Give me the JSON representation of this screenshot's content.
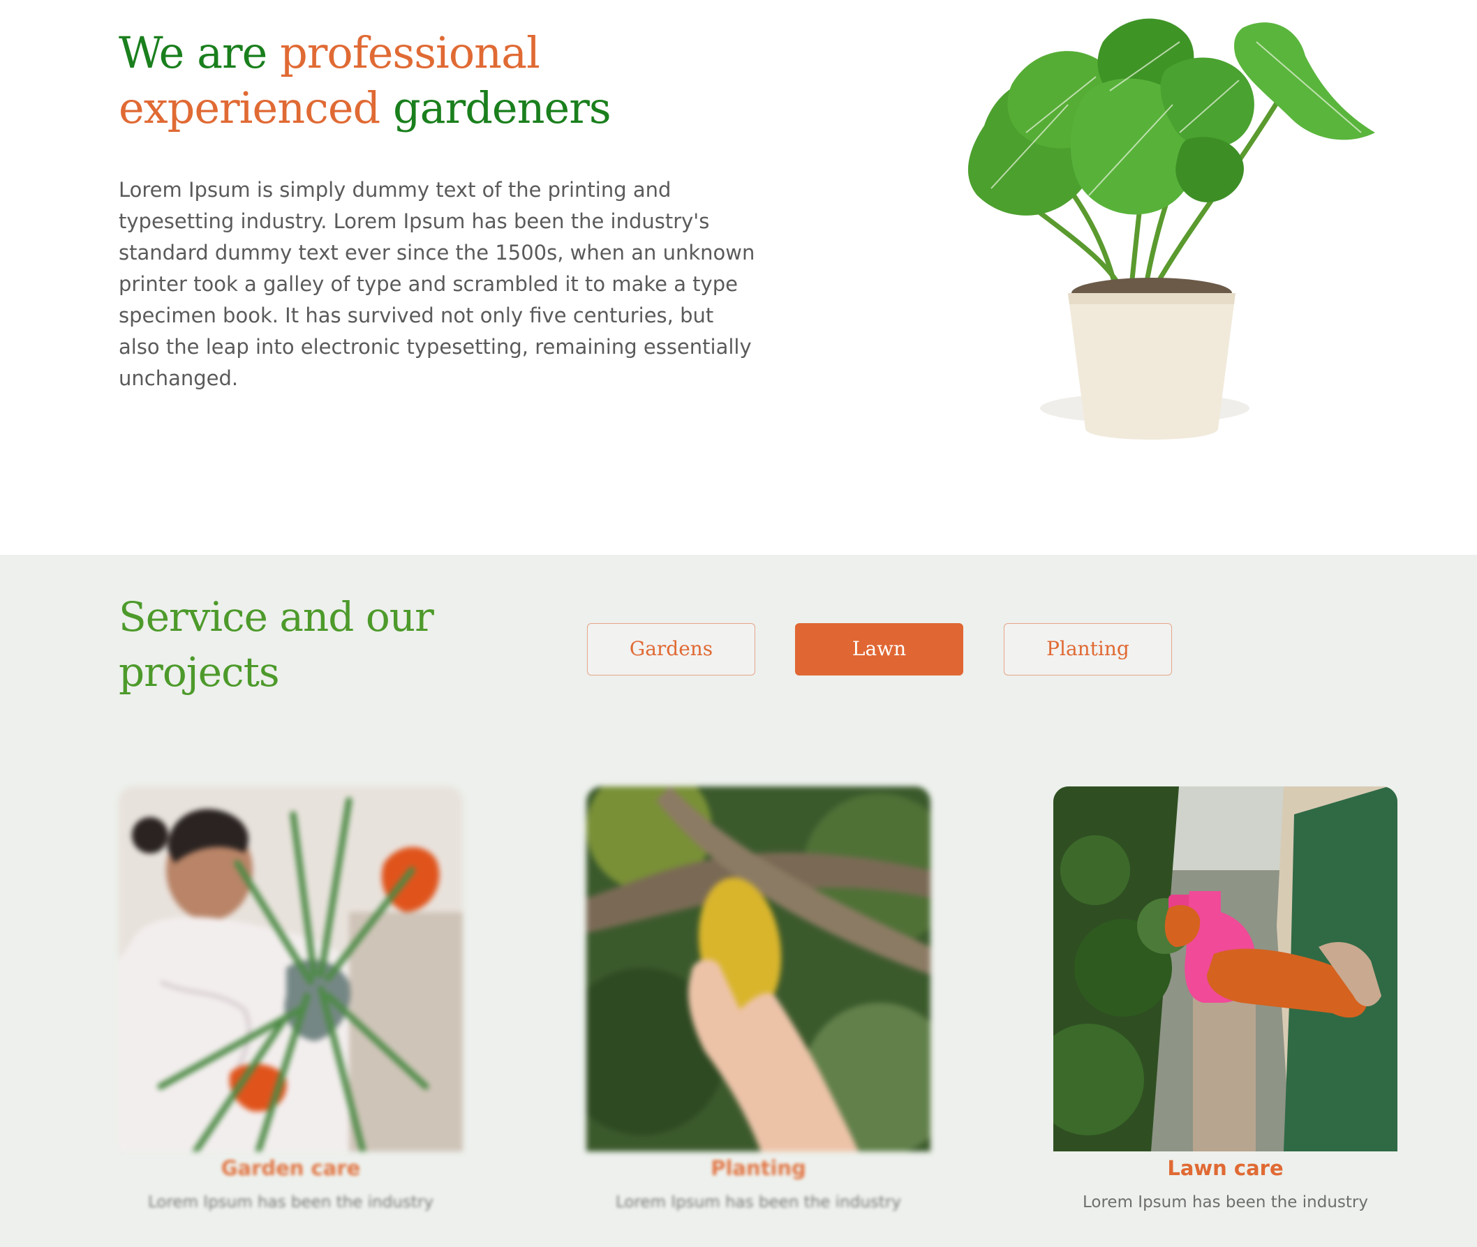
{
  "hero": {
    "title": {
      "part1": "We are",
      "part2": "professional",
      "part3": "experienced",
      "part4": "gardeners"
    },
    "paragraph": "Lorem Ipsum is simply dummy text of the printing and typesetting industry. Lorem Ipsum has been the industry's standard dummy text ever since the 1500s, when an unknown printer took a galley of type and scrambled it to make a type specimen book. It has survived not only five centuries, but also the leap into electronic typesetting, remaining essentially unchanged."
  },
  "services": {
    "title": "Service and our projects",
    "tabs": [
      {
        "label": "Gardens",
        "active": false
      },
      {
        "label": "Lawn",
        "active": true
      },
      {
        "label": "Planting",
        "active": false
      }
    ],
    "cards": [
      {
        "title": "Garden care",
        "text": "Lorem Ipsum has been the industry"
      },
      {
        "title": "Planting",
        "text": "Lorem Ipsum has been the industry"
      },
      {
        "title": "Lawn care",
        "text": "Lorem Ipsum has been the industry"
      }
    ]
  },
  "colors": {
    "accent_orange": "#e06a34",
    "heading_green": "#1a7f1d",
    "section_green": "#4d9a2b",
    "section_background": "#edf0ec"
  }
}
